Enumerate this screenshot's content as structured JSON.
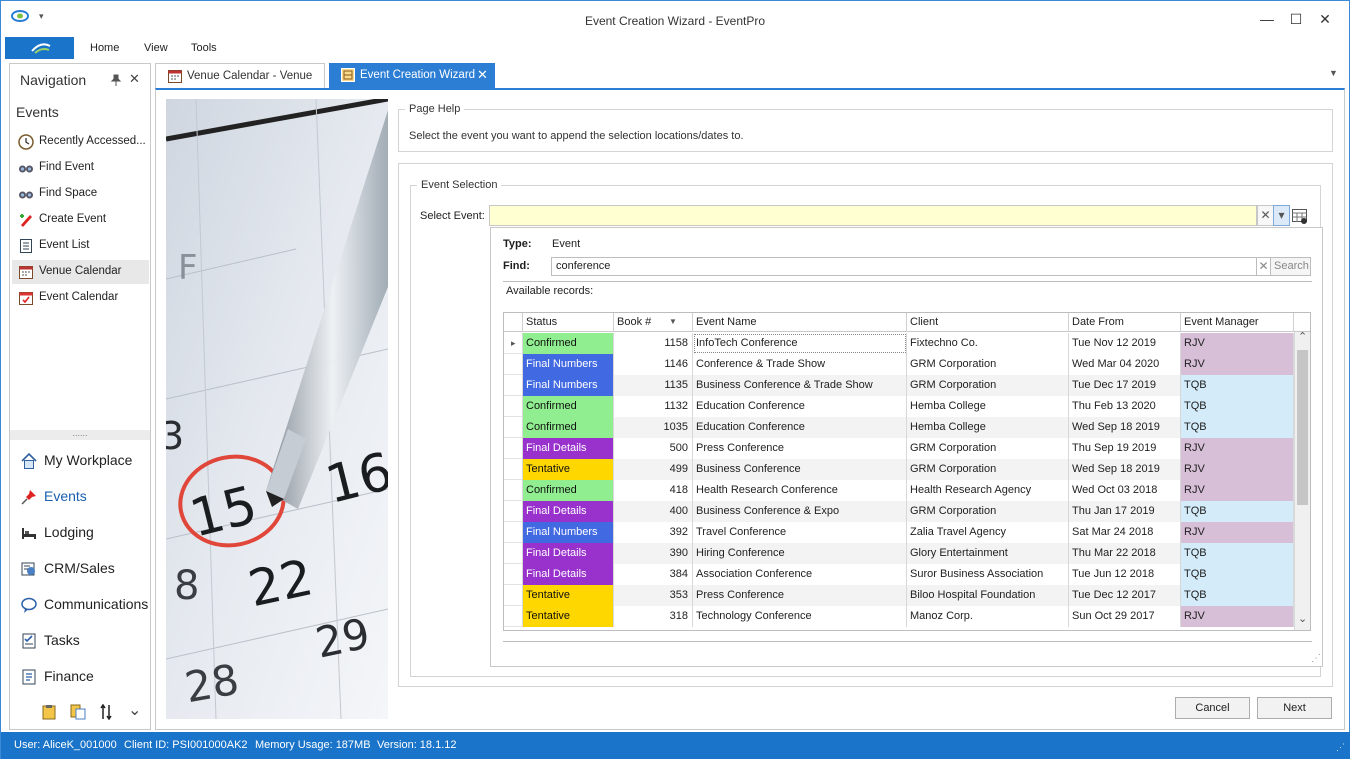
{
  "window": {
    "title": "Event Creation Wizard - EventPro",
    "minimize": "—",
    "maximize": "☐",
    "close": "✕",
    "quick_access": "▾"
  },
  "ribbon": {
    "tabs": [
      "Home",
      "View",
      "Tools"
    ]
  },
  "nav": {
    "title": "Navigation",
    "pin": "📌",
    "close": "✕",
    "section": "Events",
    "items": [
      {
        "label": "Recently Accessed...",
        "icon": "clock-icon"
      },
      {
        "label": "Find Event",
        "icon": "binoculars-icon"
      },
      {
        "label": "Find Space",
        "icon": "binoculars-icon"
      },
      {
        "label": "Create Event",
        "icon": "create-event-icon"
      },
      {
        "label": "Event List",
        "icon": "list-icon"
      },
      {
        "label": "Venue Calendar",
        "icon": "calendar-icon",
        "selected": true
      },
      {
        "label": "Event Calendar",
        "icon": "calendar-icon"
      }
    ],
    "splitter": "......",
    "modules": [
      {
        "label": "My Workplace",
        "icon": "home-icon"
      },
      {
        "label": "Events",
        "icon": "pushpin-icon"
      },
      {
        "label": "Lodging",
        "icon": "bed-icon"
      },
      {
        "label": "CRM/Sales",
        "icon": "crm-icon"
      },
      {
        "label": "Communications",
        "icon": "chat-icon"
      },
      {
        "label": "Tasks",
        "icon": "tasks-icon"
      },
      {
        "label": "Finance",
        "icon": "finance-icon"
      }
    ],
    "bottom_more": "⌄"
  },
  "doc_tabs": [
    {
      "label": "Venue Calendar - Venue",
      "active": false
    },
    {
      "label": "Event Creation Wizard",
      "active": true,
      "close": "✕"
    }
  ],
  "tab_menu": "▼",
  "page_help": {
    "legend": "Page Help",
    "text": "Select the event you want to append the selection locations/dates to."
  },
  "event_selection": {
    "legend": "Event Selection",
    "select_label": "Select Event:",
    "select_value": "",
    "clear": "✕",
    "dropdown": "▾"
  },
  "popup": {
    "type_label": "Type:",
    "type_value": "Event",
    "find_label": "Find:",
    "find_value": "conference",
    "find_clear": "✕",
    "search_label": "Search",
    "available_label": "Available records:",
    "columns": [
      "Status",
      "Book #",
      "Event Name",
      "Client",
      "Date From",
      "Event Manager"
    ],
    "sort_indicator": "▼",
    "row_indicator": "▸",
    "rows": [
      {
        "status": "Confirmed",
        "book": "1158",
        "event": "InfoTech Conference",
        "client": "Fixtechno Co.",
        "date": "Tue Nov 12 2019",
        "manager": "RJV"
      },
      {
        "status": "Final Numbers",
        "book": "1146",
        "event": "Conference & Trade Show",
        "client": "GRM Corporation",
        "date": "Wed Mar 04 2020",
        "manager": "RJV"
      },
      {
        "status": "Final Numbers",
        "book": "1135",
        "event": "Business Conference & Trade Show",
        "client": "GRM Corporation",
        "date": "Tue Dec 17 2019",
        "manager": "TQB"
      },
      {
        "status": "Confirmed",
        "book": "1132",
        "event": "Education Conference",
        "client": "Hemba College",
        "date": "Thu Feb 13 2020",
        "manager": "TQB"
      },
      {
        "status": "Confirmed",
        "book": "1035",
        "event": "Education Conference",
        "client": "Hemba College",
        "date": "Wed Sep 18 2019",
        "manager": "TQB"
      },
      {
        "status": "Final Details",
        "book": "500",
        "event": "Press Conference",
        "client": "GRM Corporation",
        "date": "Thu Sep 19 2019",
        "manager": "RJV"
      },
      {
        "status": "Tentative",
        "book": "499",
        "event": "Business Conference",
        "client": "GRM Corporation",
        "date": "Wed Sep 18 2019",
        "manager": "RJV"
      },
      {
        "status": "Confirmed",
        "book": "418",
        "event": "Health Research Conference",
        "client": "Health Research Agency",
        "date": "Wed Oct 03 2018",
        "manager": "RJV"
      },
      {
        "status": "Final Details",
        "book": "400",
        "event": "Business Conference & Expo",
        "client": "GRM Corporation",
        "date": "Thu Jan 17 2019",
        "manager": "TQB"
      },
      {
        "status": "Final Numbers",
        "book": "392",
        "event": "Travel Conference",
        "client": "Zalia Travel Agency",
        "date": "Sat Mar 24 2018",
        "manager": "RJV"
      },
      {
        "status": "Final Details",
        "book": "390",
        "event": "Hiring Conference",
        "client": "Glory Entertainment",
        "date": "Thu Mar 22 2018",
        "manager": "TQB"
      },
      {
        "status": "Final Details",
        "book": "384",
        "event": "Association Conference",
        "client": "Suror Business Association",
        "date": "Tue Jun 12 2018",
        "manager": "TQB"
      },
      {
        "status": "Tentative",
        "book": "353",
        "event": "Press Conference",
        "client": "Biloo Hospital Foundation",
        "date": "Tue Dec 12 2017",
        "manager": "TQB"
      },
      {
        "status": "Tentative",
        "book": "318",
        "event": "Technology Conference",
        "client": "Manoz Corp.",
        "date": "Sun Oct 29 2017",
        "manager": "RJV"
      }
    ],
    "scroll_up": "⌃",
    "scroll_down": "⌄",
    "grip": "⋰"
  },
  "status_colors": {
    "Confirmed": "#90ee90",
    "Final Numbers": "#4169e1",
    "Final Details": "#9932cc",
    "Tentative": "#ffd700"
  },
  "manager_colors": {
    "RJV": "#d8bfd8",
    "TQB": "#d4ecfa"
  },
  "buttons": {
    "cancel": "Cancel",
    "next": "Next"
  },
  "calendar_photo": {
    "numbers": [
      "15",
      "16",
      "22",
      "29",
      "28",
      "3",
      "8",
      "F"
    ]
  },
  "statusbar": {
    "user": "User: AliceK_001000",
    "client": "Client ID: PSI001000AK2",
    "memory": "Memory Usage: 187MB",
    "version": "Version: 18.1.12",
    "grip": "⋰"
  },
  "accent": "#1a74c9"
}
